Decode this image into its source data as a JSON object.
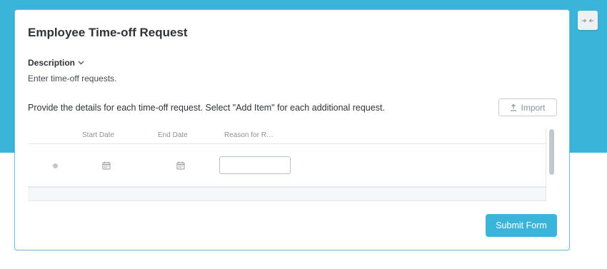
{
  "form": {
    "title": "Employee Time-off Request",
    "description_toggle_label": "Description",
    "description_text": "Enter time-off requests.",
    "instructions": "Provide the details for each time-off request. Select \"Add Item\" for each additional request.",
    "import_label": "Import",
    "submit_label": "Submit Form"
  },
  "table": {
    "columns": [
      "Start Date",
      "End Date",
      "Reason for R…"
    ],
    "rows": [
      {
        "start_date": "",
        "end_date": "",
        "reason": ""
      }
    ]
  },
  "icons": {
    "collapse": "collapse-arrows-icon",
    "chevron": "chevron-down-icon",
    "import": "upload-icon",
    "calendar": "calendar-icon"
  },
  "colors": {
    "accent": "#3bb4d9",
    "card_border": "#67c2df"
  }
}
